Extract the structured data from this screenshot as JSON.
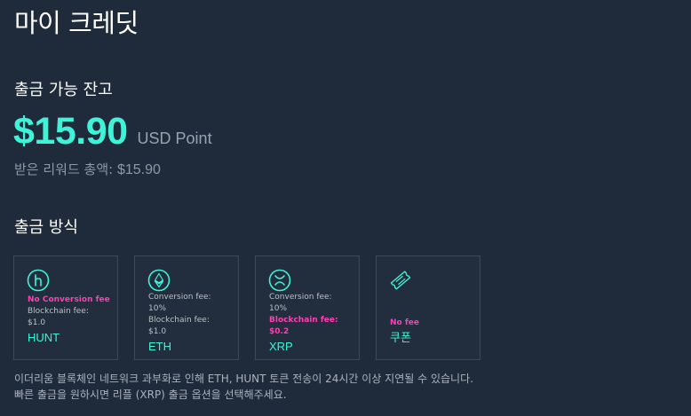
{
  "page": {
    "title": "마이 크레딧"
  },
  "balance": {
    "section_title": "출금 가능 잔고",
    "amount": "$15.90",
    "unit": "USD Point",
    "total_label": "받은 리워드 총액:",
    "total_value": "$15.90"
  },
  "withdraw": {
    "section_title": "출금 방식",
    "methods": [
      {
        "icon": "hunt-icon",
        "lines": [
          "No Conversion fee",
          "Blockchain fee:",
          "$1.0"
        ],
        "name": "HUNT"
      },
      {
        "icon": "ethereum-icon",
        "lines": [
          "Conversion fee:",
          "10%",
          "Blockchain fee:",
          "$1.0"
        ],
        "name": "ETH"
      },
      {
        "icon": "xrp-icon",
        "lines": [
          "Conversion fee:",
          "10%",
          "Blockchain fee:",
          "$0.2"
        ],
        "name": "XRP"
      },
      {
        "icon": "coupon-icon",
        "lines": [
          "No fee"
        ],
        "name": "쿠폰"
      }
    ]
  },
  "notice": {
    "line1": "이더리움 블록체인 네트워크 과부화로 인해 ETH, HUNT 토큰 전송이 24시간 이상 지연될 수 있습니다.",
    "line2": "빠른 출금을 원하시면 리플 (XRP) 출금 옵션을 선택해주세요."
  },
  "colors": {
    "background": "#1f2a3a",
    "accent": "#3ff3d9",
    "highlight": "#ff3fb4",
    "card_border": "#3c4757"
  }
}
